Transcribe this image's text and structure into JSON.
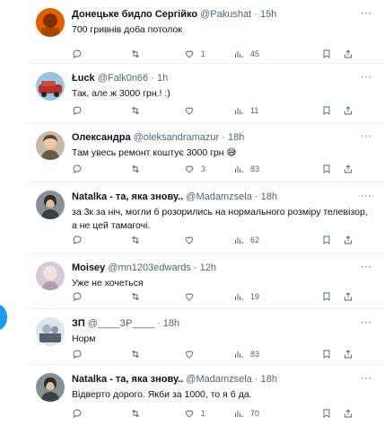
{
  "tweets": [
    {
      "name": "Донецьке бидло Сергійко",
      "handle": "@Pakushat",
      "time": "15h",
      "text": "700 гривнів доба потолок",
      "replies": "",
      "retweets": "",
      "likes": "1",
      "views": "45",
      "avatar": {
        "bg": "#e65c00",
        "fg": "#7a3300"
      }
    },
    {
      "name": "Łuck",
      "handle": "@Falk0n66",
      "time": "1h",
      "text": "Так, але ж 3000 грн.! :)",
      "replies": "",
      "retweets": "",
      "likes": "",
      "views": "11",
      "avatar": {
        "bg": "#b3342e",
        "fg": "#e8e8e8"
      }
    },
    {
      "name": "Олександра",
      "handle": "@oleksandramazur",
      "time": "18h",
      "text": "Там увесь ремонт коштує 3000 грн 😅",
      "replies": "",
      "retweets": "",
      "likes": "3",
      "views": "83",
      "avatar": {
        "bg": "#c7b9a6",
        "fg": "#6b5a45"
      }
    },
    {
      "name": "Natalka - та, яка знову..",
      "handle": "@Madamzsela",
      "time": "18h",
      "text": "за 3к за ніч, могли б розорились на нормального розміру телевізор, а не цей тамагочі.",
      "replies": "",
      "retweets": "",
      "likes": "",
      "views": "62",
      "avatar": {
        "bg": "#8a8f96",
        "fg": "#3c4148"
      }
    },
    {
      "name": "Moisey",
      "handle": "@mn1203edwards",
      "time": "12h",
      "text": "Уже не хочеться",
      "replies": "",
      "retweets": "",
      "likes": "",
      "views": "19",
      "avatar": {
        "bg": "#d9c9d6",
        "fg": "#b59bb0"
      }
    },
    {
      "name": "ЗП",
      "handle": "@____ЗР____",
      "time": "18h",
      "text": "Норм",
      "replies": "",
      "retweets": "",
      "likes": "",
      "views": "83",
      "avatar": {
        "bg": "#dfe6ea",
        "fg": "#556070"
      }
    },
    {
      "name": "Natalka - та, яка знову..",
      "handle": "@Madamzsela",
      "time": "18h",
      "text": "Відверто дорого. Якби за 1000, то я б да.",
      "replies": "",
      "retweets": "",
      "likes": "1",
      "views": "70",
      "avatar": {
        "bg": "#8a8f96",
        "fg": "#3c4148"
      }
    }
  ],
  "ui": {
    "dot": "·",
    "more": "···"
  },
  "colors": {
    "accent": "#1d9bf0",
    "secondary_text": "#536471",
    "divider": "#eff3f4"
  }
}
